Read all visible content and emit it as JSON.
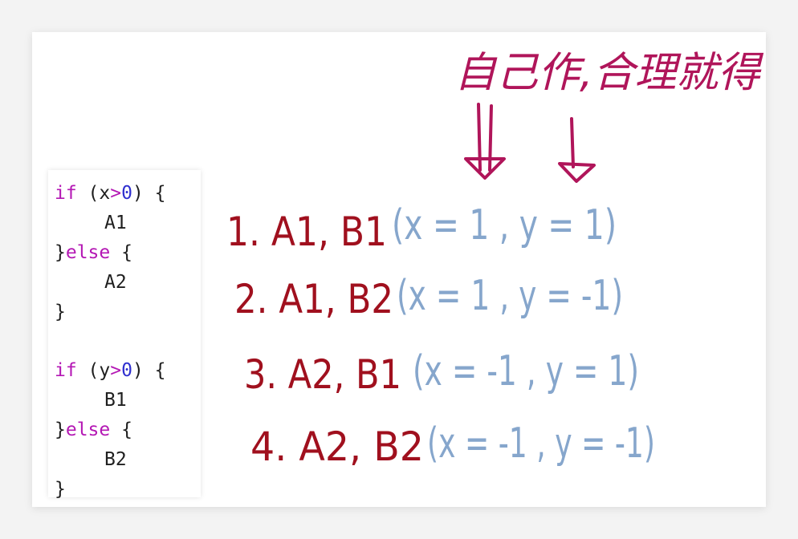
{
  "code": {
    "block1": {
      "if_kw": "if",
      "cond_open": " (x",
      "cond_op": ">",
      "cond_num": "0",
      "cond_close": ") {",
      "body": "A1",
      "close_brace": "}",
      "else_kw": "else",
      "else_open": " {",
      "else_body": "A2",
      "end_brace": "}"
    },
    "block2": {
      "if_kw": "if",
      "cond_open": " (y",
      "cond_op": ">",
      "cond_num": "0",
      "cond_close": ") {",
      "body": "B1",
      "close_brace": "}",
      "else_kw": "else",
      "else_open": " {",
      "else_body": "B2",
      "end_brace": "}"
    }
  },
  "note": {
    "text": "自己作,合理就得",
    "color": "#b0155a"
  },
  "combos": [
    {
      "label": "1. A1, B1",
      "params": "(x = 1 , y = 1)"
    },
    {
      "label": "2. A1, B2",
      "params": "(x = 1 , y = -1)"
    },
    {
      "label": "3. A2, B1",
      "params": "(x = -1 , y = 1)"
    },
    {
      "label": "4. A2, B2",
      "params": "(x = -1 , y = -1)"
    }
  ],
  "colors": {
    "label_ink": "#a0101e",
    "param_ink": "#86a6cc",
    "keyword": "#b418b4",
    "number": "#2f2fcf"
  }
}
